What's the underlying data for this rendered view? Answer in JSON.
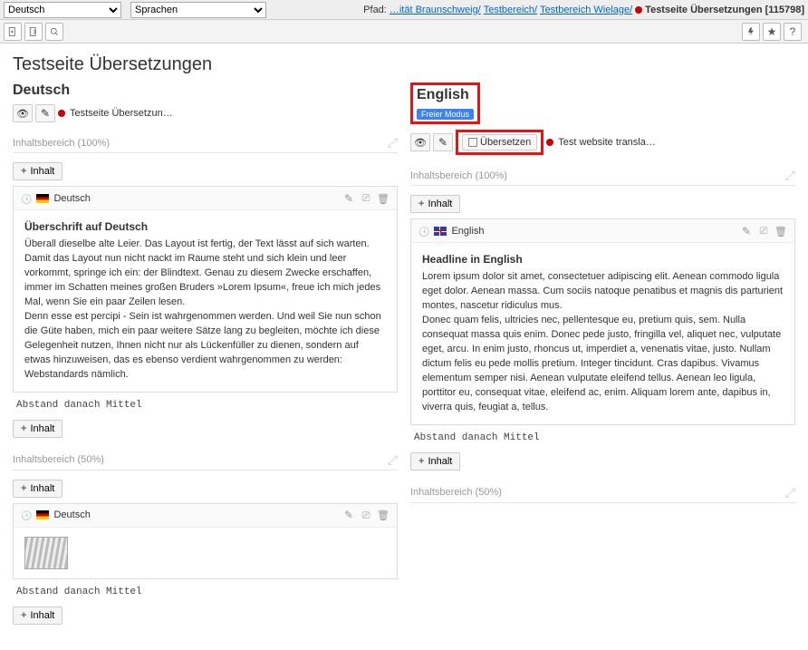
{
  "top": {
    "lang_select": "Deutsch",
    "sprachen_select": "Sprachen",
    "path_label": "Pfad:",
    "path_parts": [
      "…ität Braunschweig/",
      "Testbereich/",
      "Testbereich Wielage/"
    ],
    "current_page": "Testseite Übersetzungen",
    "page_id": "[115798]"
  },
  "page_title": "Testseite Übersetzungen",
  "left": {
    "heading": "Deutsch",
    "page_label": "Testseite Übersetzun…",
    "section1": "Inhaltsbereich (100%)",
    "section2": "Inhaltsbereich (50%)",
    "add_label": "Inhalt",
    "card1": {
      "title": "Deutsch",
      "headline": "Überschrift auf Deutsch",
      "para1": "Überall dieselbe alte Leier. Das Layout ist fertig, der Text lässt auf sich warten. Damit das Layout nun nicht nackt im Raume steht und sich klein und leer vorkommt, springe ich ein: der Blindtext. Genau zu diesem Zwecke erschaffen, immer im Schatten meines großen Bruders »Lorem Ipsum«, freue ich mich jedes Mal, wenn Sie ein paar Zeilen lesen.",
      "para2": "Denn esse est percipi - Sein ist wahrgenommen werden. Und weil Sie nun schon die Güte haben, mich ein paar weitere Sätze lang zu begleiten, möchte ich diese Gelegenheit nutzen, Ihnen nicht nur als Lückenfüller zu dienen, sondern auf etwas hinzuweisen, das es ebenso verdient wahrgenommen zu werden: Webstandards nämlich."
    },
    "card2": {
      "title": "Deutsch"
    },
    "meta_label": "Abstand danach",
    "meta_val": "Mittel"
  },
  "right": {
    "heading": "English",
    "badge": "Freier Modus",
    "translate_btn": "Übersetzen",
    "page_label": "Test website transla…",
    "section1": "Inhaltsbereich (100%)",
    "section2": "Inhaltsbereich (50%)",
    "add_label": "Inhalt",
    "card1": {
      "title": "English",
      "headline": "Headline in English",
      "para1": "Lorem ipsum dolor sit amet, consectetuer adipiscing elit. Aenean commodo ligula eget dolor. Aenean massa. Cum sociis natoque penatibus et magnis dis parturient montes, nascetur ridiculus mus.",
      "para2": "Donec quam felis, ultricies nec, pellentesque eu, pretium quis, sem. Nulla consequat massa quis enim. Donec pede justo, fringilla vel, aliquet nec, vulputate eget, arcu. In enim justo, rhoncus ut, imperdiet a, venenatis vitae, justo. Nullam dictum felis eu pede mollis pretium. Integer tincidunt. Cras dapibus. Vivamus elementum semper nisi. Aenean vulputate eleifend tellus. Aenean leo ligula, porttitor eu, consequat vitae, eleifend ac, enim. Aliquam lorem ante, dapibus in, viverra quis, feugiat a, tellus."
    },
    "meta_label": "Abstand danach",
    "meta_val": "Mittel"
  }
}
